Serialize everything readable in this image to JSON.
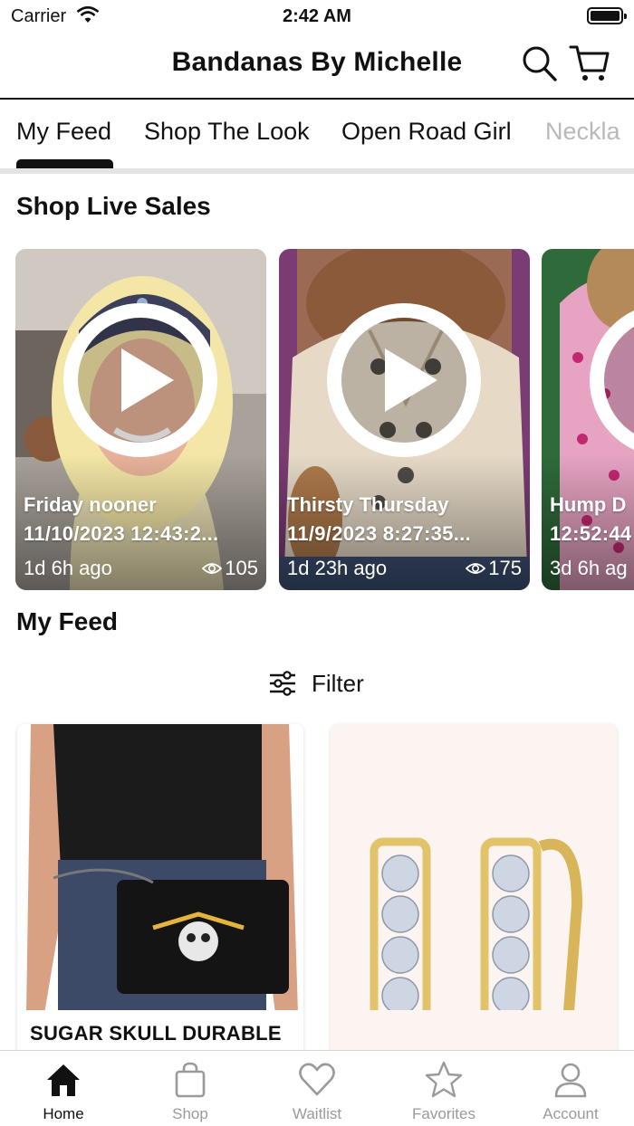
{
  "status_bar": {
    "carrier": "Carrier",
    "time": "2:42 AM"
  },
  "header": {
    "title": "Bandanas By Michelle"
  },
  "tabs": [
    {
      "label": "My Feed",
      "active": true
    },
    {
      "label": "Shop The Look"
    },
    {
      "label": "Open Road Girl"
    },
    {
      "label": "Neckla"
    }
  ],
  "live_section": {
    "title": "Shop Live Sales"
  },
  "live_sales": [
    {
      "title": "Friday nooner",
      "date": "11/10/2023 12:43:2...",
      "ago": "1d 6h ago",
      "views": "105"
    },
    {
      "title": "Thirsty Thursday",
      "date": "11/9/2023 8:27:35...",
      "ago": "1d 23h ago",
      "views": "175"
    },
    {
      "title": "Hump D",
      "date": "12:52:44",
      "ago": "3d 6h ag",
      "views": ""
    }
  ],
  "feed_section": {
    "title": "My Feed"
  },
  "filter": {
    "label": "Filter"
  },
  "feed_items": [
    {
      "name": "SUGAR SKULL DURABLE"
    },
    {
      "name": ""
    }
  ],
  "tab_bar": [
    {
      "label": "Home",
      "icon": "home-icon",
      "active": true
    },
    {
      "label": "Shop",
      "icon": "bag-icon"
    },
    {
      "label": "Waitlist",
      "icon": "heart-icon"
    },
    {
      "label": "Favorites",
      "icon": "star-icon"
    },
    {
      "label": "Account",
      "icon": "person-icon"
    }
  ],
  "colors": {
    "accent": "#111111",
    "inactive": "#9a9a9a",
    "divider": "#e3e3e3"
  }
}
